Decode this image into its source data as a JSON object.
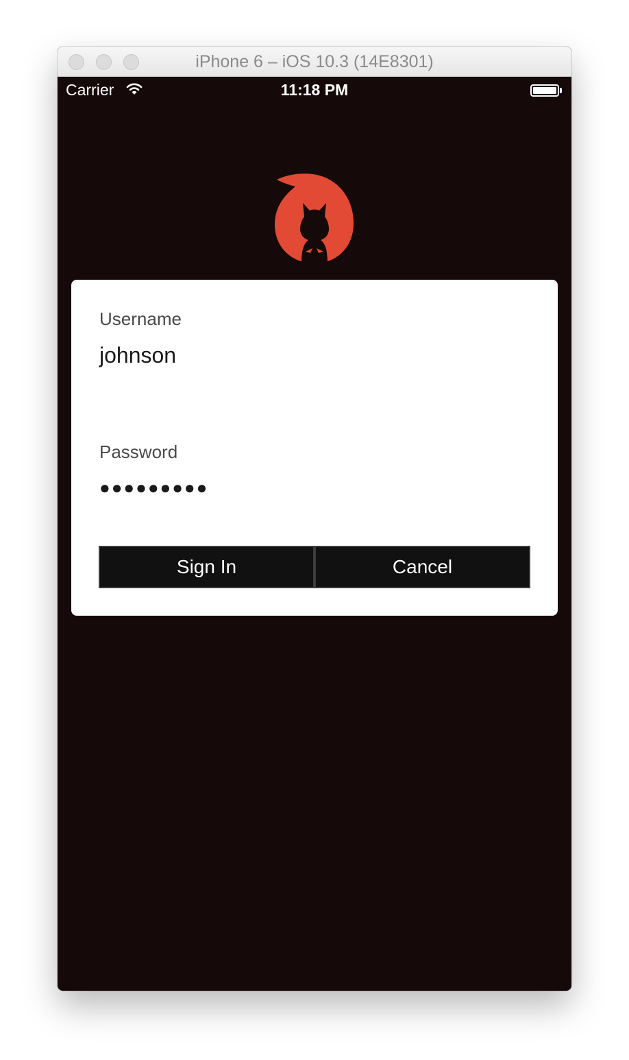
{
  "window": {
    "title": "iPhone 6 – iOS 10.3 (14E8301)"
  },
  "status_bar": {
    "carrier": "Carrier",
    "time": "11:18 PM",
    "battery_level": 1.0,
    "icons": [
      "wifi-icon",
      "battery-icon"
    ]
  },
  "logo": {
    "icon": "flame-mascot-logo",
    "color": "#e34a35"
  },
  "login": {
    "username_label": "Username",
    "username_value": "johnson",
    "password_label": "Password",
    "password_masked": "●●●●●●●●●",
    "sign_in_label": "Sign In",
    "cancel_label": "Cancel"
  },
  "colors": {
    "background": "#160909",
    "card": "#ffffff",
    "button": "#111111",
    "accent": "#e34a35"
  }
}
